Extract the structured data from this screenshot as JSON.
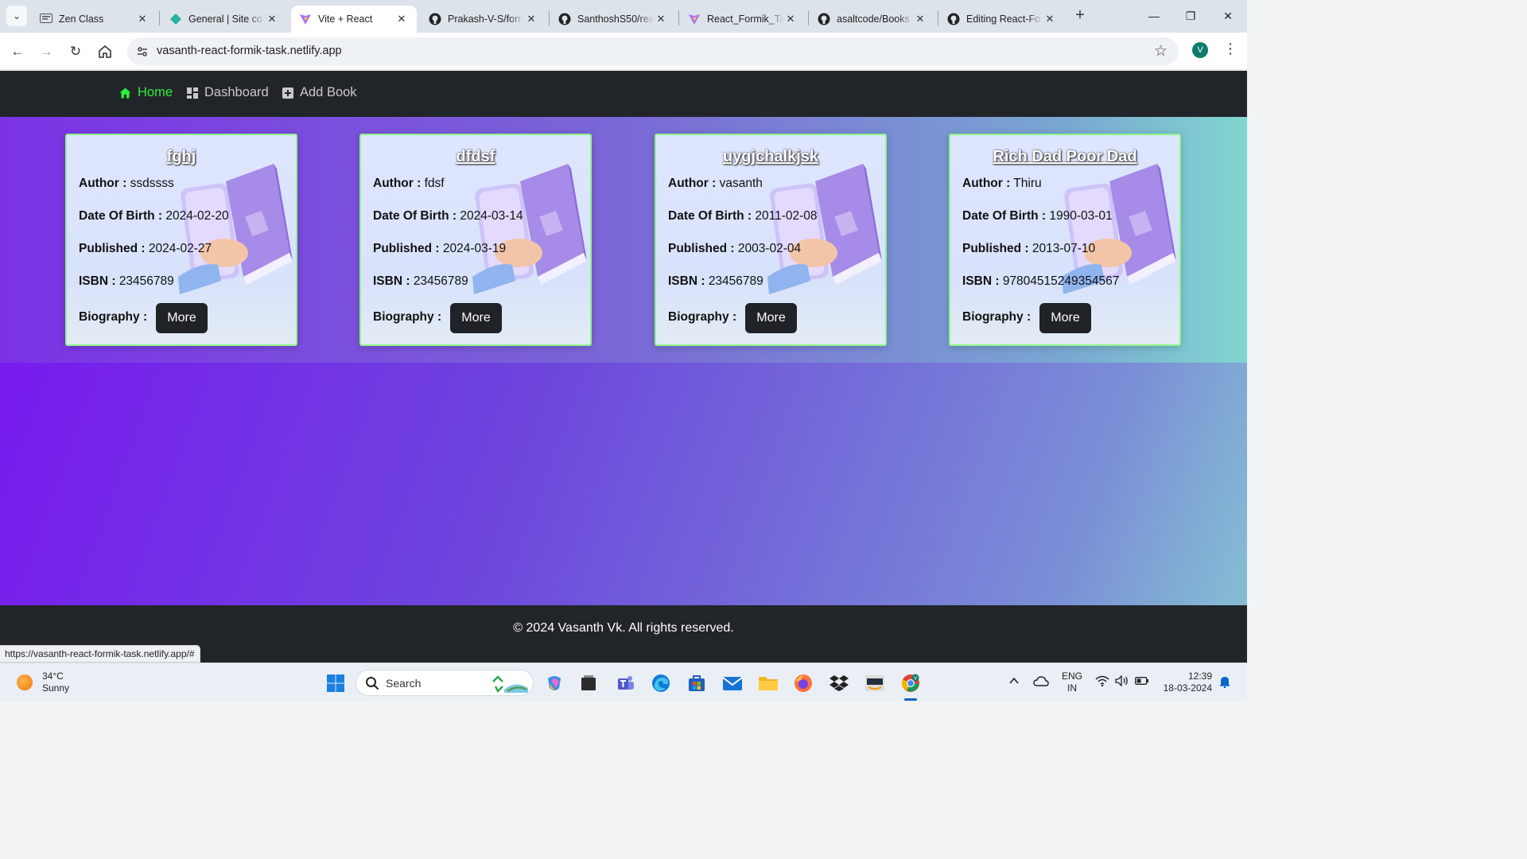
{
  "browser": {
    "tabs": [
      {
        "title": "Zen Class",
        "icon": "zen-class-icon",
        "active": false
      },
      {
        "title": "General | Site co",
        "icon": "netlify-icon",
        "active": false
      },
      {
        "title": "Vite + React",
        "icon": "vite-icon",
        "active": true
      },
      {
        "title": "Prakash-V-S/forr",
        "icon": "github-icon",
        "active": false
      },
      {
        "title": "SanthoshS50/rea",
        "icon": "github-icon",
        "active": false
      },
      {
        "title": "React_Formik_Ta",
        "icon": "vite-icon",
        "active": false
      },
      {
        "title": "asaltcode/Books",
        "icon": "github-icon",
        "active": false
      },
      {
        "title": "Editing React-Fo",
        "icon": "github-icon",
        "active": false
      }
    ],
    "url": "vasanth-react-formik-task.netlify.app",
    "profile_initial": "V",
    "status_url": "https://vasanth-react-formik-task.netlify.app/#"
  },
  "nav": {
    "links": [
      {
        "label": "Home",
        "icon": "home-icon",
        "active": true
      },
      {
        "label": "Dashboard",
        "icon": "dashboard-icon",
        "active": false
      },
      {
        "label": "Add Book",
        "icon": "add-book-icon",
        "active": false
      }
    ]
  },
  "labels": {
    "author": "Author :",
    "dob": "Date Of Birth :",
    "published": "Published :",
    "isbn": "ISBN :",
    "biography": "Biography :",
    "more": "More"
  },
  "books": [
    {
      "title": "fghj",
      "author": "ssdssss",
      "dob": "2024-02-20",
      "published": "2024-02-27",
      "isbn": "23456789"
    },
    {
      "title": "dfdsf",
      "author": "fdsf",
      "dob": "2024-03-14",
      "published": "2024-03-19",
      "isbn": "23456789"
    },
    {
      "title": "uygjchalkjsk",
      "author": "vasanth",
      "dob": "2011-02-08",
      "published": "2003-02-04",
      "isbn": "23456789"
    },
    {
      "title": "Rich Dad Poor Dad",
      "author": "Thiru",
      "dob": "1990-03-01",
      "published": "2013-07-10",
      "isbn": "97804515249354567"
    }
  ],
  "footer": {
    "text": "© 2024 Vasanth Vk. All rights reserved."
  },
  "taskbar": {
    "weather_temp": "34°C",
    "weather_desc": "Sunny",
    "search_label": "Search",
    "lang_line1": "ENG",
    "lang_line2": "IN",
    "time": "12:39",
    "date": "18-03-2024"
  },
  "colors": {
    "nav_bg": "#212529",
    "nav_active": "#2bf03a",
    "card_border": "#8ef58a",
    "button_bg": "#1f2226"
  }
}
